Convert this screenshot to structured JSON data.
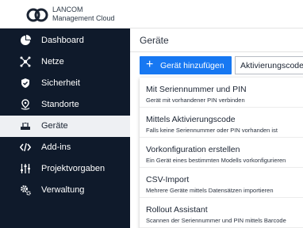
{
  "header": {
    "brand_line1": "LANCOM",
    "brand_line2": "Management Cloud"
  },
  "sidebar": {
    "items": [
      {
        "label": "Dashboard",
        "icon": "dashboard-icon"
      },
      {
        "label": "Netze",
        "icon": "network-icon"
      },
      {
        "label": "Sicherheit",
        "icon": "shield-icon"
      },
      {
        "label": "Standorte",
        "icon": "location-icon"
      },
      {
        "label": "Geräte",
        "icon": "device-icon",
        "active": true
      },
      {
        "label": "Add-ins",
        "icon": "code-icon"
      },
      {
        "label": "Projektvorgaben",
        "icon": "sliders-icon"
      },
      {
        "label": "Verwaltung",
        "icon": "gears-icon"
      }
    ]
  },
  "main": {
    "title": "Geräte",
    "add_button": "Gerät hinzufügen",
    "activation_button": "Aktivierungscodes",
    "menu": [
      {
        "title": "Mit Seriennummer und PIN",
        "subtitle": "Gerät mit vorhandener PIN verbinden"
      },
      {
        "title": "Mittels Aktivierungscode",
        "subtitle": "Falls keine Seriennummer oder PIN vorhanden ist"
      },
      {
        "title": "Vorkonfiguration erstellen",
        "subtitle": "Ein Gerät eines bestimmten Modells vorkonfigurieren"
      },
      {
        "title": "CSV-Import",
        "subtitle": "Mehrere Geräte mittels Datensätzen importieren"
      },
      {
        "title": "Rollout Assistant",
        "subtitle": "Scannen der Seriennummer und PIN mittels Barcode"
      }
    ]
  },
  "colors": {
    "sidebar_bg": "#0f1a2b",
    "accent": "#1778f2",
    "active_bg": "#eef0f3"
  }
}
